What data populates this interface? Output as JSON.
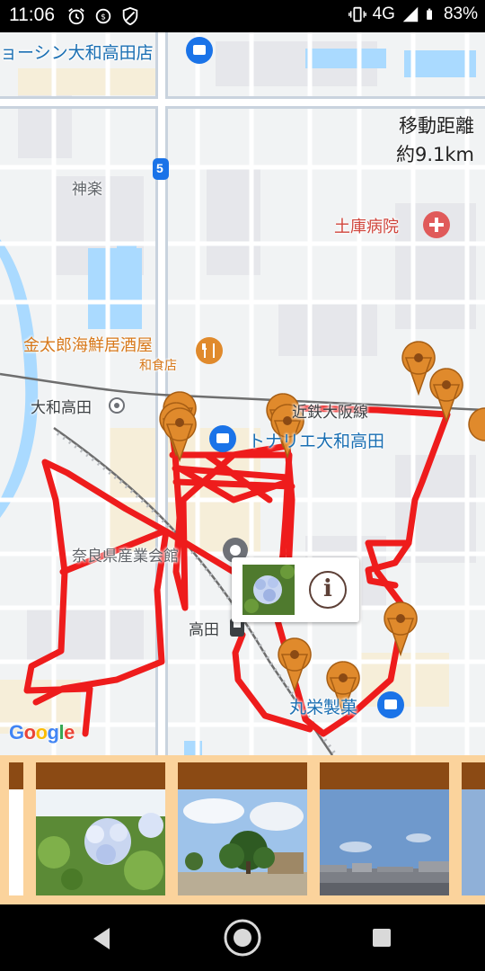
{
  "status_bar": {
    "time": "11:06",
    "left_icons": [
      "alarm-icon",
      "data-saver-icon",
      "shield-icon"
    ],
    "right_icons": [
      "vibrate-icon",
      "signal-icon",
      "battery-icon"
    ],
    "network": "4G",
    "battery": "83%"
  },
  "map": {
    "labels": {
      "shop_top": "ョーシン大和高田店",
      "kagura": "神楽",
      "road_number": "5",
      "hospital": "土庫病院",
      "restaurant": "金太郎海鮮居酒屋",
      "restaurant_sub": "和食店",
      "station_yamato": "大和高田",
      "railway": "近鉄大阪線",
      "mall": "トナリエ大和高田",
      "hall": "奈良県産業会館",
      "station_takada": "高田",
      "confectionery": "丸栄製菓"
    },
    "distance": {
      "title": "移動距離",
      "value": "約9.1km"
    },
    "route_color": "#ee1c1c",
    "marker_color": "#e08a2c",
    "google_logo": [
      "G",
      "o",
      "o",
      "g",
      "l",
      "e"
    ]
  },
  "popup": {
    "thumbnail": "hydrangea-photo",
    "info_icon": "i"
  },
  "photo_strip": {
    "photos": [
      "hydrangea-photo",
      "park-tree-photo",
      "cityscape-photo"
    ]
  },
  "nav_bar": {
    "buttons": [
      "back-icon",
      "home-icon",
      "recents-icon"
    ]
  }
}
